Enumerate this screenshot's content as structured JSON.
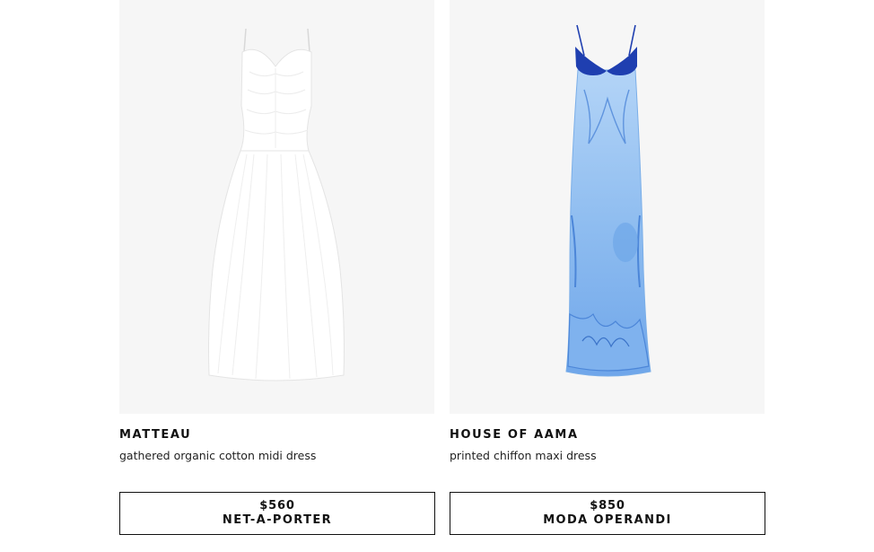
{
  "products": [
    {
      "brand": "MATTEAU",
      "description": "gathered organic cotton midi dress",
      "price": "$560",
      "retailer": "NET-A-PORTER",
      "image": "white-midi-dress-image"
    },
    {
      "brand": "HOUSE OF AAMA",
      "description": "printed chiffon maxi dress",
      "price": "$850",
      "retailer": "MODA OPERANDI",
      "image": "blue-maxi-dress-image"
    }
  ],
  "colors": {
    "image_background": "#f6f6f6",
    "text": "#111111",
    "button_border": "#111111",
    "dress_1": "#ffffff",
    "dress_2_bodice": "#1f3fb0",
    "dress_2_skirt": "#8fbdf0"
  }
}
